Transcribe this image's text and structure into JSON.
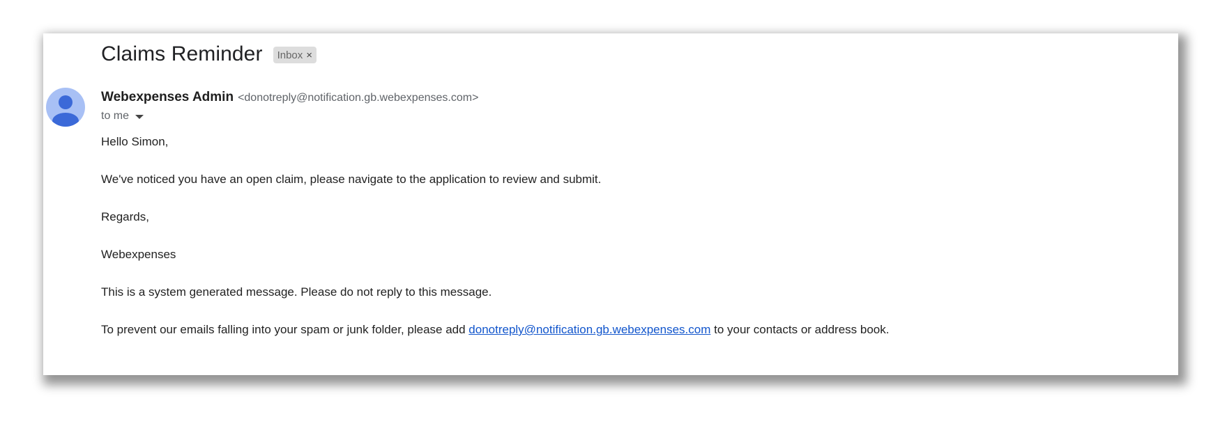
{
  "email": {
    "subject": "Claims Reminder",
    "label": "Inbox",
    "label_close": "×",
    "sender_name": "Webexpenses Admin",
    "sender_email": "<donotreply@notification.gb.webexpenses.com>",
    "recipient": "to me",
    "greeting": "Hello Simon,",
    "paragraph1": "We've noticed you have an open claim, please navigate to the application to review and submit.",
    "regards": "Regards,",
    "signature": "Webexpenses",
    "system_note": "This is a system generated message. Please do not reply to this message.",
    "spam_prefix": "To prevent our emails falling into your spam or junk folder, please add ",
    "spam_link": "donotreply@notification.gb.webexpenses.com",
    "spam_suffix": " to your contacts or address book."
  },
  "icons": {
    "avatar": "person-avatar-icon",
    "label_close": "close-icon",
    "recipient_details": "caret-down-icon"
  },
  "colors": {
    "avatar_bg": "#a8c0f5",
    "avatar_fg": "#3b69d8",
    "link": "#1155cc",
    "chip_bg": "#dddddd"
  }
}
